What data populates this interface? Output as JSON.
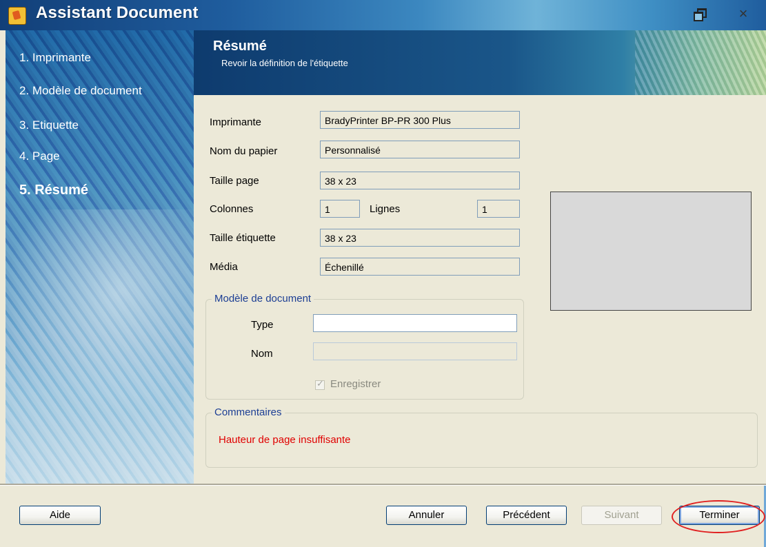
{
  "window": {
    "title": "Assistant Document",
    "restore_icon": "restore-icon",
    "close_symbol": "×"
  },
  "nav": {
    "items": [
      {
        "label": "1. Imprimante"
      },
      {
        "label": "2. Modèle de document"
      },
      {
        "label": "3. Etiquette"
      },
      {
        "label": "4. Page"
      },
      {
        "label": "5. Résumé",
        "active": true
      }
    ]
  },
  "header": {
    "title": "Résumé",
    "subtitle": "Revoir la définition de l'étiquette"
  },
  "summary": {
    "printer_label": "Imprimante",
    "printer_value": "BradyPrinter BP-PR 300 Plus",
    "paper_label": "Nom du papier",
    "paper_value": "Personnalisé",
    "page_size_label": "Taille page",
    "page_size_value": "38 x 23",
    "columns_label": "Colonnes",
    "columns_value": "1",
    "rows_label": "Lignes",
    "rows_value": "1",
    "label_size_label": "Taille étiquette",
    "label_size_value": "38 x 23",
    "media_label": "Média",
    "media_value": "Échenillé"
  },
  "template_group": {
    "legend": "Modèle de document",
    "type_label": "Type",
    "type_value": "",
    "name_label": "Nom",
    "name_value": "",
    "save_label": "Enregistrer",
    "save_checked": true
  },
  "comments": {
    "legend": "Commentaires",
    "text": "Hauteur de page insuffisante"
  },
  "buttons": {
    "help": "Aide",
    "cancel": "Annuler",
    "previous": "Précédent",
    "next": "Suivant",
    "finish": "Terminer"
  },
  "colors": {
    "error_text": "#e00000",
    "group_legend": "#1c3e94",
    "highlight": "#e02020"
  }
}
